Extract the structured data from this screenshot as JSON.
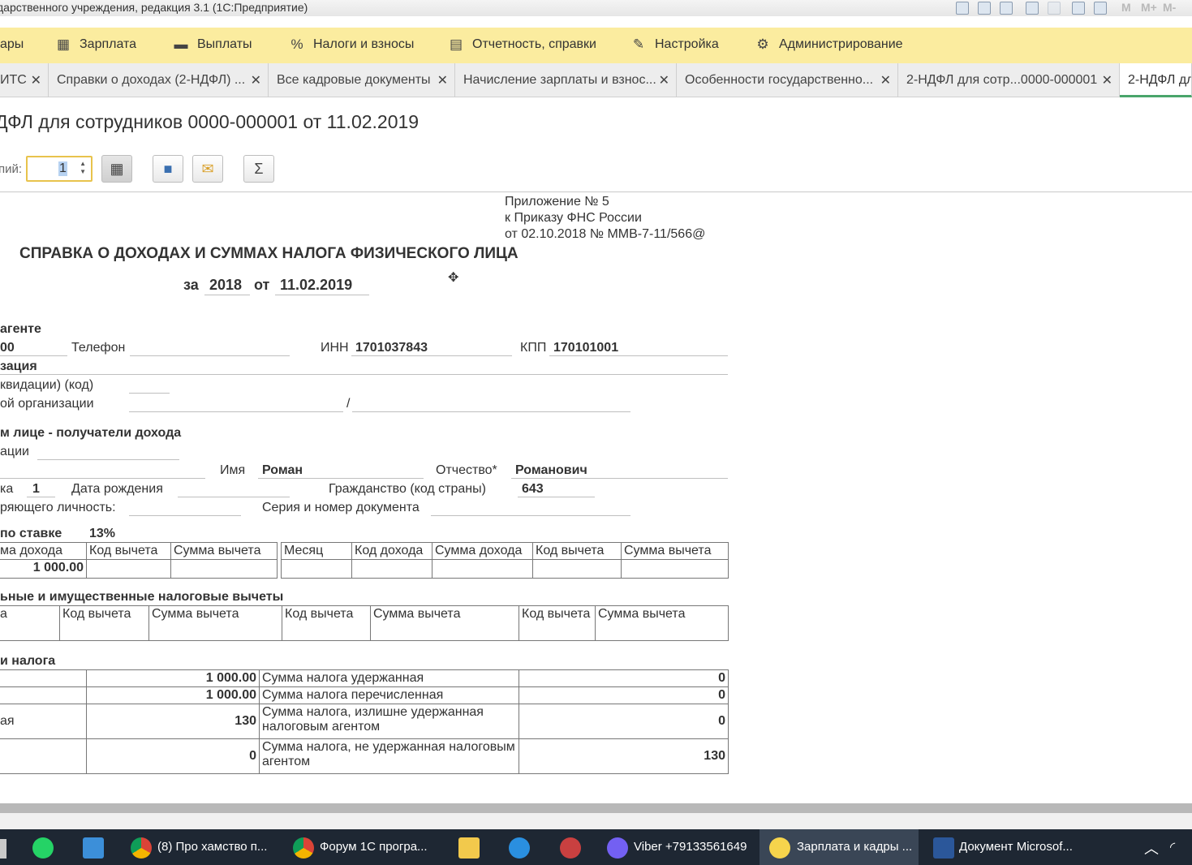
{
  "window": {
    "title": "дарственного учреждения, редакция 3.1  (1С:Предприятие)",
    "toolbar_text": [
      "M",
      "M+",
      "M-"
    ]
  },
  "menu": [
    {
      "label": "ары",
      "icon": ""
    },
    {
      "label": "Зарплата",
      "icon": "calculator-icon"
    },
    {
      "label": "Выплаты",
      "icon": "wallet-icon"
    },
    {
      "label": "Налоги и взносы",
      "icon": "percent-icon"
    },
    {
      "label": "Отчетность, справки",
      "icon": "reports-icon"
    },
    {
      "label": "Настройка",
      "icon": "wrench-icon"
    },
    {
      "label": "Администрирование",
      "icon": "gear-icon"
    }
  ],
  "tabs": [
    {
      "label": "ИТС"
    },
    {
      "label": "Справки о доходах (2-НДФЛ) ..."
    },
    {
      "label": "Все кадровые документы"
    },
    {
      "label": "Начисление зарплаты и взнос..."
    },
    {
      "label": "Особенности государственно..."
    },
    {
      "label": "2-НДФЛ для сотр...0000-000001"
    },
    {
      "label": "2-НДФЛ дл"
    }
  ],
  "doc_title": "ДФЛ для сотрудников 0000-000001 от 11.02.2019",
  "copies": {
    "label": "пий:",
    "value": "1"
  },
  "form": {
    "appendix": [
      "Приложение № 5",
      "к Приказу ФНС России",
      "от 02.10.2018 № ММВ-7-11/566@"
    ],
    "heading": "СПРАВКА О ДОХОДАХ И СУММАХ НАЛОГА ФИЗИЧЕСКОГО ЛИЦА",
    "za": "за",
    "year": "2018",
    "ot": "от",
    "date": "11.02.2019",
    "sec1": "агенте",
    "code_tail": "00",
    "phone_label": "Телефон",
    "inn_label": "ИНН",
    "inn": "1701037843",
    "kpp_label": "КПП",
    "kpp": "170101001",
    "org_label": "зация",
    "liq_label": "квидации)  (код)",
    "reorg_label": "ой организации",
    "slash": "/",
    "sec2": "м лице - получатели дохода",
    "inn_person_label": "ации",
    "name_label": "Имя",
    "name": "Роман",
    "patronymic_label": "Отчество*",
    "patronymic": "Романович",
    "status_label": "ка",
    "status": "1",
    "dob_label": "Дата рождения",
    "citizenship_label": "Гражданство (код страны)",
    "citizenship": "643",
    "doc_label": "ряющего личность:",
    "doc_series_label": "Серия и номер документа",
    "sec3_label": "по ставке",
    "rate": "13%",
    "t1_head_left": [
      "ма дохода",
      "Код вычета",
      "Сумма вычета"
    ],
    "t1_row_left": [
      "1 000.00",
      "",
      ""
    ],
    "t1_head_right": [
      "Месяц",
      "Код дохода",
      "Сумма дохода",
      "Код вычета",
      "Сумма вычета"
    ],
    "sec4": "ьные и имущественные налоговые вычеты",
    "t2_head": [
      "а",
      "Код вычета",
      "Сумма вычета",
      "Код вычета",
      "Сумма вычета",
      "Код вычета",
      "Сумма вычета"
    ],
    "sec5": "и налога",
    "t3": [
      {
        "a": "",
        "b": "1 000.00",
        "c": "Сумма налога удержанная",
        "d": "0"
      },
      {
        "a": "",
        "b": "1 000.00",
        "c": "Сумма налога перечисленная",
        "d": "0"
      },
      {
        "a": "ая",
        "b": "130",
        "c": "Сумма налога, излишне удержанная налоговым агентом",
        "d": "0"
      },
      {
        "a": "",
        "b": "0",
        "c": "Сумма налога, не удержанная налоговым агентом",
        "d": "130"
      }
    ]
  },
  "taskbar": [
    {
      "label": "",
      "icon": "whatsapp-icon"
    },
    {
      "label": "",
      "icon": "contacts-icon"
    },
    {
      "label": "(8) Про хамство п...",
      "icon": "chrome-icon"
    },
    {
      "label": "Форум 1С програ...",
      "icon": "chrome-icon"
    },
    {
      "label": "",
      "icon": "folder-icon"
    },
    {
      "label": "",
      "icon": "ie-icon"
    },
    {
      "label": "",
      "icon": "tool-icon"
    },
    {
      "label": "Viber +79133561649",
      "icon": "viber-icon"
    },
    {
      "label": "Зарплата и кадры ...",
      "icon": "onec-icon"
    },
    {
      "label": "Документ Microsof...",
      "icon": "word-icon"
    }
  ]
}
